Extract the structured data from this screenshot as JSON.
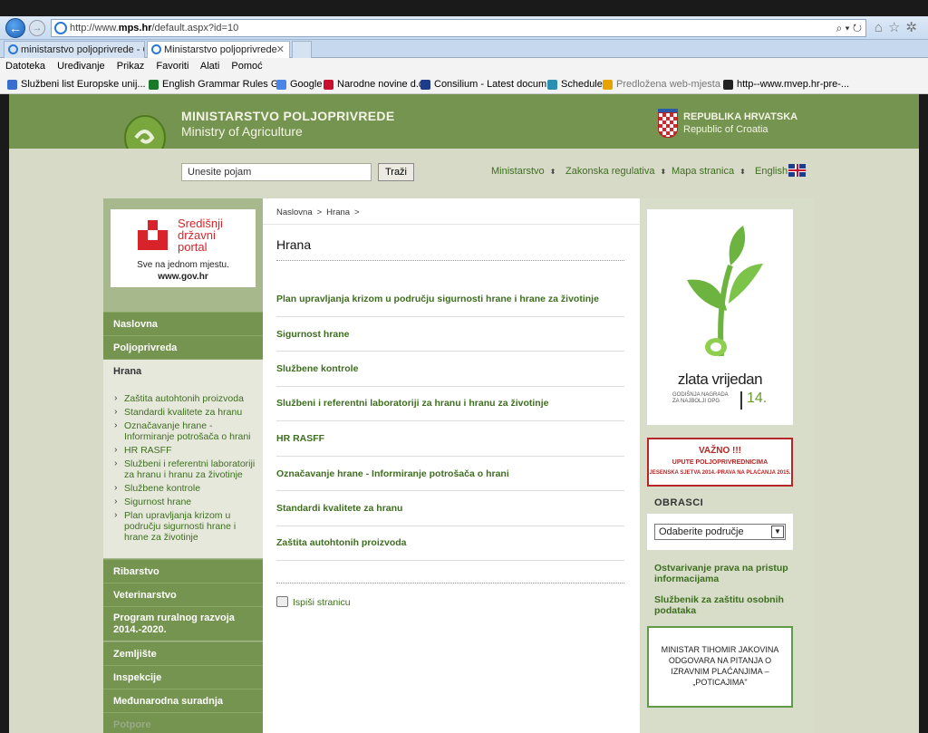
{
  "browser": {
    "url_prefix": "http://www.",
    "url_host": "mps.hr",
    "url_path": "/default.aspx?id=10",
    "url_tools": "⌕ ▾ ↻",
    "tabs": [
      {
        "label": "ministarstvo poljoprivrede - G..."
      },
      {
        "label": "Ministarstvo poljoprivrede"
      }
    ],
    "menu": [
      "Datoteka",
      "Uređivanje",
      "Prikaz",
      "Favoriti",
      "Alati",
      "Pomoć"
    ],
    "favorites": [
      {
        "label": "Službeni list Europske unij...",
        "color": "#2b66c6"
      },
      {
        "label": "English Grammar Rules G...",
        "color": "#1a7a2a"
      },
      {
        "label": "Google",
        "color": "#4a86e8"
      },
      {
        "label": "Narodne novine d.d",
        "color": "#c8102e"
      },
      {
        "label": "Consilium - Latest docum...",
        "color": "#1f3c8a"
      },
      {
        "label": "Schedule",
        "color": "#2a8fb0"
      },
      {
        "label": "Predložena web-mjesta ▾",
        "color": "#e6a400"
      },
      {
        "label": "http--www.mvep.hr-pre-...",
        "color": "#222"
      }
    ]
  },
  "header": {
    "title_hr": "MINISTARSTVO POLJOPRIVREDE",
    "title_en": "Ministry of Agriculture",
    "republic_hr": "REPUBLIKA HRVATSKA",
    "republic_en": "Republic of Croatia"
  },
  "search": {
    "value": "Unesite pojam",
    "button": "Traži"
  },
  "topnav": [
    {
      "label": "Ministarstvo"
    },
    {
      "label": "Zakonska regulativa"
    },
    {
      "label": "Mapa stranica"
    },
    {
      "label": "English"
    }
  ],
  "portal": {
    "title": "Središnji državni portal",
    "title_l1": "Središnji",
    "title_l2": "državni",
    "title_l3": "portal",
    "tagline": "Sve na jednom mjestu.",
    "url": "www.gov.hr"
  },
  "leftnav": {
    "items": [
      "Naslovna",
      "Poljoprivreda",
      "Hrana",
      "Ribarstvo",
      "Veterinarstvo",
      "Program ruralnog razvoja 2014.-2020.",
      "Zemljište",
      "Inspekcije",
      "Međunarodna suradnja",
      "Potpore"
    ],
    "program_l1": "Program ruralnog razvoja",
    "program_l2": "2014.-2020.",
    "sub": [
      "Zaštita autohtonih proizvoda",
      "Standardi kvalitete za hranu",
      "Označavanje hrane - Informiranje potrošača o hrani",
      "HR RASFF",
      "Službeni i referentni laboratoriji za hranu i hranu za životinje",
      "Službene kontrole",
      "Sigurnost hrane",
      "Plan upravljanja krizom u području sigurnosti hrane i hrane za životinje"
    ]
  },
  "main": {
    "breadcrumb": [
      "Naslovna",
      "Hrana"
    ],
    "bc_sep": ">",
    "title": "Hrana",
    "links": [
      "Plan upravljanja krizom u području sigurnosti hrane i hrane za životinje",
      "Sigurnost hrane",
      "Službene kontrole",
      "Službeni i referentni laboratoriji za hranu i hranu za životinje",
      "HR RASFF",
      "Označavanje hrane - Informiranje potrošača o hrani",
      "Standardi kvalitete za hranu",
      "Zaštita autohtonih proizvoda"
    ],
    "print": "Ispiši stranicu"
  },
  "right": {
    "promo_title": "zlata vrijedan",
    "promo_sub_l1": "GODIŠNJA NAGRADA",
    "promo_sub_l2": "ZA NAJBOLJI OPG",
    "promo_year": "14.",
    "vazno_title": "VAŽNO !!!",
    "vazno_line1": "UPUTE POLJOPRIVREDNICIMA",
    "vazno_line2": "JESENSKA SJETVA 2014.-PRAVA NA PLAĆANJA 2015.",
    "obrasci_title": "OBRASCI",
    "obrasci_select": "Odaberite područje",
    "link1": "Ostvarivanje prava na pristup informacijama",
    "link2": "Službenik za zaštitu osobnih podataka",
    "minister_box": "MINISTAR TIHOMIR JAKOVINA ODGOVARA NA PITANJA O IZRAVNIM PLAĆANJIMA – „POTICAJIMA\""
  },
  "colors": {
    "header_green": "#74944f",
    "link_green": "#3d6e1e",
    "alert_red": "#b52626"
  }
}
